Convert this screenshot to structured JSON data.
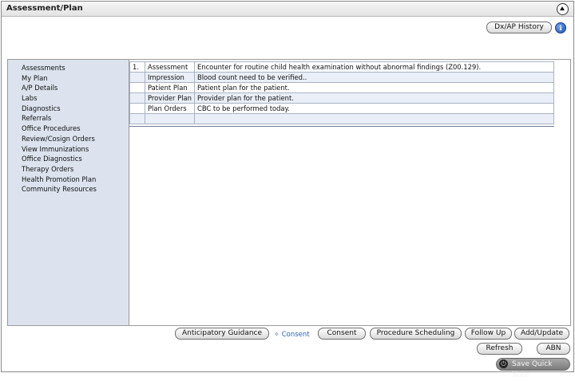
{
  "header": {
    "title": "Assessment/Plan"
  },
  "toolbar": {
    "dx_history_label": "Dx/AP History"
  },
  "sidebar": {
    "items": [
      "Assessments",
      "My Plan",
      "A/P Details",
      "Labs",
      "Diagnostics",
      "Referrals",
      "Office Procedures",
      "Review/Cosign Orders",
      "View Immunizations",
      "Office Diagnostics",
      "Therapy Orders",
      "Health Promotion Plan",
      "Community Resources"
    ]
  },
  "plan_table": {
    "number": "1.",
    "rows": [
      {
        "type": "Assessment",
        "text": "Encounter for routine child health examination without abnormal findings (Z00.129)."
      },
      {
        "type": "Impression",
        "text": "Blood count need to be verified.."
      },
      {
        "type": "Patient Plan",
        "text": "Patient plan for the patient."
      },
      {
        "type": "Provider Plan",
        "text": "Provider plan for the patient."
      },
      {
        "type": "Plan Orders",
        "text": "CBC to be performed today."
      }
    ]
  },
  "actions": {
    "anticipatory_guidance": "Anticipatory Guidance",
    "consent_link": "Consent",
    "consent": "Consent",
    "procedure_scheduling": "Procedure Scheduling",
    "follow_up": "Follow Up",
    "add_update": "Add/Update",
    "refresh": "Refresh",
    "abn": "ABN",
    "save_quick_note": "Save Quick Note"
  },
  "icons": {
    "collapse": "chevron-up-circle-icon",
    "info": "info-icon",
    "consent": "sparkle-icon",
    "save": "power-icon"
  },
  "colors": {
    "sidebar_bg": "#dce3ee",
    "link": "#2f63b7",
    "info_icon": "#1d4fb5",
    "save_button": "#8f8f8f"
  }
}
